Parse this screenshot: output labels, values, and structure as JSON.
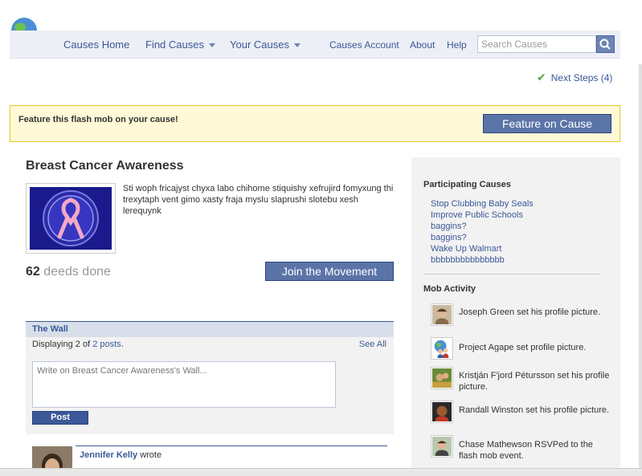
{
  "nav": {
    "home": "Causes Home",
    "find": "Find Causes",
    "your": "Your Causes",
    "account": "Causes Account",
    "about": "About",
    "help": "Help",
    "search_placeholder": "Search Causes",
    "icons": {
      "logo": "globe-people-logo",
      "search": "magnifier-icon"
    }
  },
  "next_steps": {
    "label": "Next Steps (4)",
    "icon": "checkmark-icon"
  },
  "feature": {
    "text": "Feature this flash mob on your cause!",
    "button": "Feature on Cause"
  },
  "cause": {
    "title": "Breast Cancer Awareness",
    "description": "Sti woph fricajyst chyxa labo chihome stiquishy xefrujird fomyxung thi trexytaph vent gimo xasty fraja myslu slaprushi slotebu xesh lerequynk",
    "deeds_count": "62",
    "deeds_label": "deeds done",
    "join_button": "Join the Movement",
    "image_icon": "pink-ribbon-icon"
  },
  "wall": {
    "title": "The Wall",
    "displaying_prefix": "Displaying 2 of",
    "posts_link": "2 posts",
    "displaying_suffix": ".",
    "see_all": "See All",
    "placeholder": "Write on Breast Cancer Awareness's Wall...",
    "post_button": "Post",
    "first_post": {
      "author": "Jennifer Kelly",
      "verb": "wrote"
    }
  },
  "sidebar": {
    "participating_title": "Participating Causes",
    "causes": [
      "Stop Clubbing Baby Seals",
      "Improve Public Schools",
      "baggins?",
      "baggins?",
      "Wake Up Walmart",
      "bbbbbbbbbbbbbbb"
    ],
    "activity_title": "Mob Activity",
    "activity": [
      {
        "text": "Joseph Green set his profile picture."
      },
      {
        "text": "Project Agape set profile picture."
      },
      {
        "text": "Kristján F'jord Pétursson set his profile picture."
      },
      {
        "text": "Randall Winston set his profile picture."
      },
      {
        "text": "Chase Mathewson RSVPed to the flash mob event."
      }
    ]
  },
  "colors": {
    "link": "#3b5998",
    "button": "#5b74a8",
    "feature_bg": "#fff9d7",
    "feature_border": "#e2c822"
  }
}
